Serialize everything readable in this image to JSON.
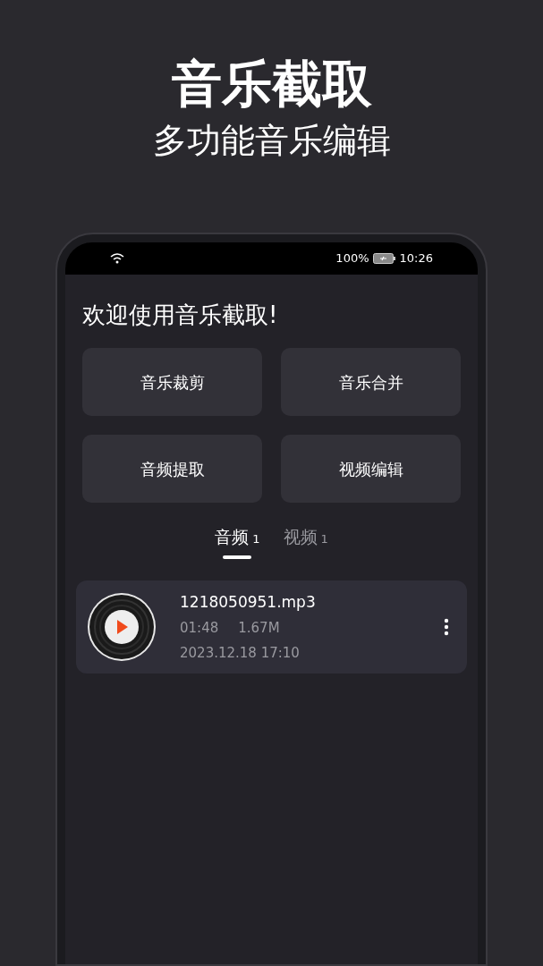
{
  "headline": "音乐截取",
  "subtitle": "多功能音乐编辑",
  "status_bar": {
    "battery": "100%",
    "time": "10:26"
  },
  "greeting": "欢迎使用音乐截取!",
  "actions": [
    "音乐裁剪",
    "音乐合并",
    "音频提取",
    "视频编辑"
  ],
  "tabs": [
    {
      "label": "音频",
      "count": "1",
      "selected": true
    },
    {
      "label": "视频",
      "count": "1",
      "selected": false
    }
  ],
  "files": [
    {
      "name": "1218050951.mp3",
      "duration": "01:48",
      "size": "1.67M",
      "date": "2023.12.18 17:10"
    }
  ]
}
